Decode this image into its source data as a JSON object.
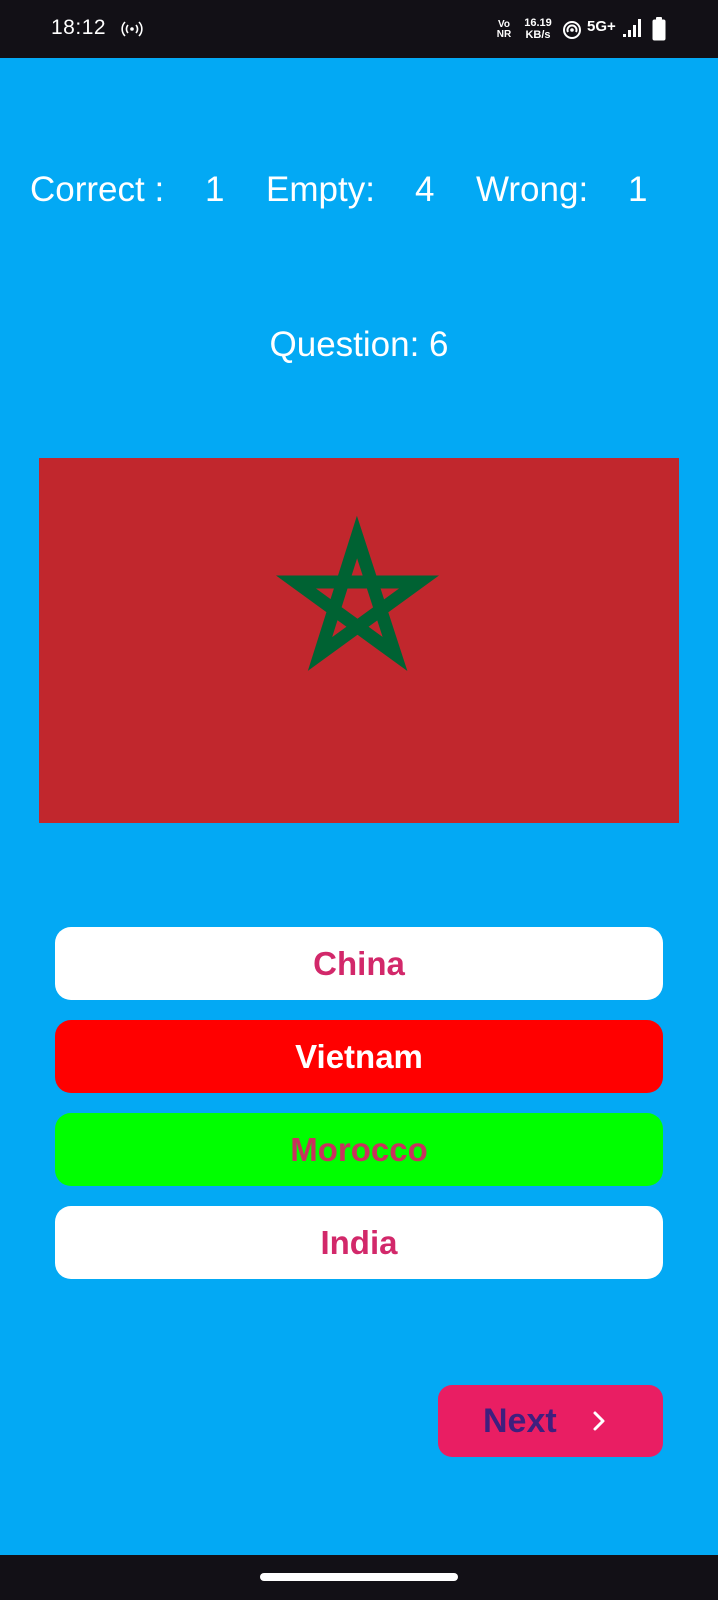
{
  "status_bar": {
    "time": "18:12",
    "vonr_line1": "Vo",
    "vonr_line2": "NR",
    "speed_value": "16.19",
    "speed_unit": "KB/s",
    "network": "5G+",
    "icons": [
      "hotspot-icon",
      "hotspot-ring-icon",
      "signal-icon",
      "battery-icon"
    ]
  },
  "score": {
    "correct_label": "Correct :",
    "correct_value": "1",
    "empty_label": "Empty:",
    "empty_value": "4",
    "wrong_label": "Wrong:",
    "wrong_value": "1"
  },
  "question": {
    "label": "Question: 6"
  },
  "flag": {
    "field_color": "#c1272d",
    "star_color": "#006233"
  },
  "options": [
    {
      "label": "China",
      "background": "#ffffff",
      "text_color": "#d2286a",
      "state": "default"
    },
    {
      "label": "Vietnam",
      "background": "#ff0000",
      "text_color": "#ffffff",
      "state": "wrong"
    },
    {
      "label": "Morocco",
      "background": "#00ff00",
      "text_color": "#c8325e",
      "state": "correct"
    },
    {
      "label": "India",
      "background": "#ffffff",
      "text_color": "#d2286a",
      "state": "default"
    }
  ],
  "next_button": {
    "label": "Next",
    "icon": "chevron-right-icon",
    "background": "#e91e63",
    "text_color": "#3f1f7e"
  },
  "colors": {
    "background": "#03a9f4",
    "system_bars": "#121016"
  }
}
